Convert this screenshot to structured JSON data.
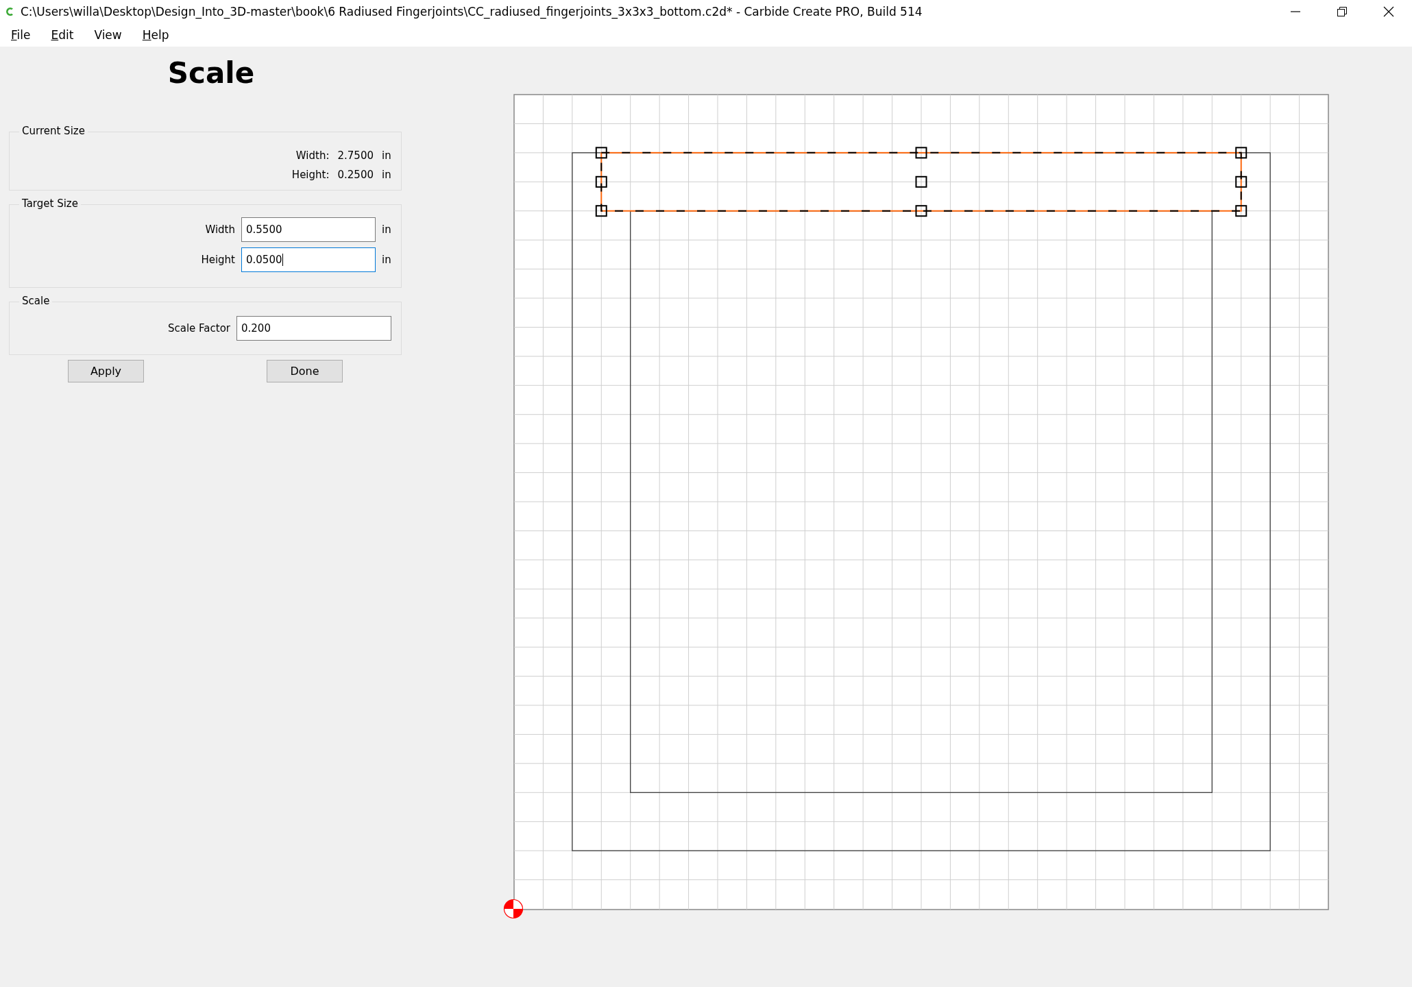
{
  "window": {
    "title": "C:\\Users\\willa\\Desktop\\Design_Into_3D-master\\book\\6 Radiused Fingerjoints\\CC_radiused_fingerjoints_3x3x3_bottom.c2d* - Carbide Create PRO, Build 514"
  },
  "menu": [
    {
      "label": "File",
      "mnemonic": true
    },
    {
      "label": "Edit",
      "mnemonic": true
    },
    {
      "label": "View",
      "mnemonic": false
    },
    {
      "label": "Help",
      "mnemonic": true
    }
  ],
  "panel": {
    "title": "Scale",
    "current_size": {
      "title": "Current Size",
      "rows": [
        {
          "label": "Width:",
          "value": "2.7500",
          "unit": "in"
        },
        {
          "label": "Height:",
          "value": "0.2500",
          "unit": "in"
        }
      ]
    },
    "target_size": {
      "title": "Target Size",
      "fields": [
        {
          "label": "Width",
          "value": "0.5500",
          "unit": "in",
          "focused": false
        },
        {
          "label": "Height",
          "value": "0.0500",
          "unit": "in",
          "focused": true
        }
      ]
    },
    "scale": {
      "title": "Scale",
      "label": "Scale Factor",
      "value": "0.200"
    },
    "buttons": [
      "Apply",
      "Done"
    ]
  }
}
